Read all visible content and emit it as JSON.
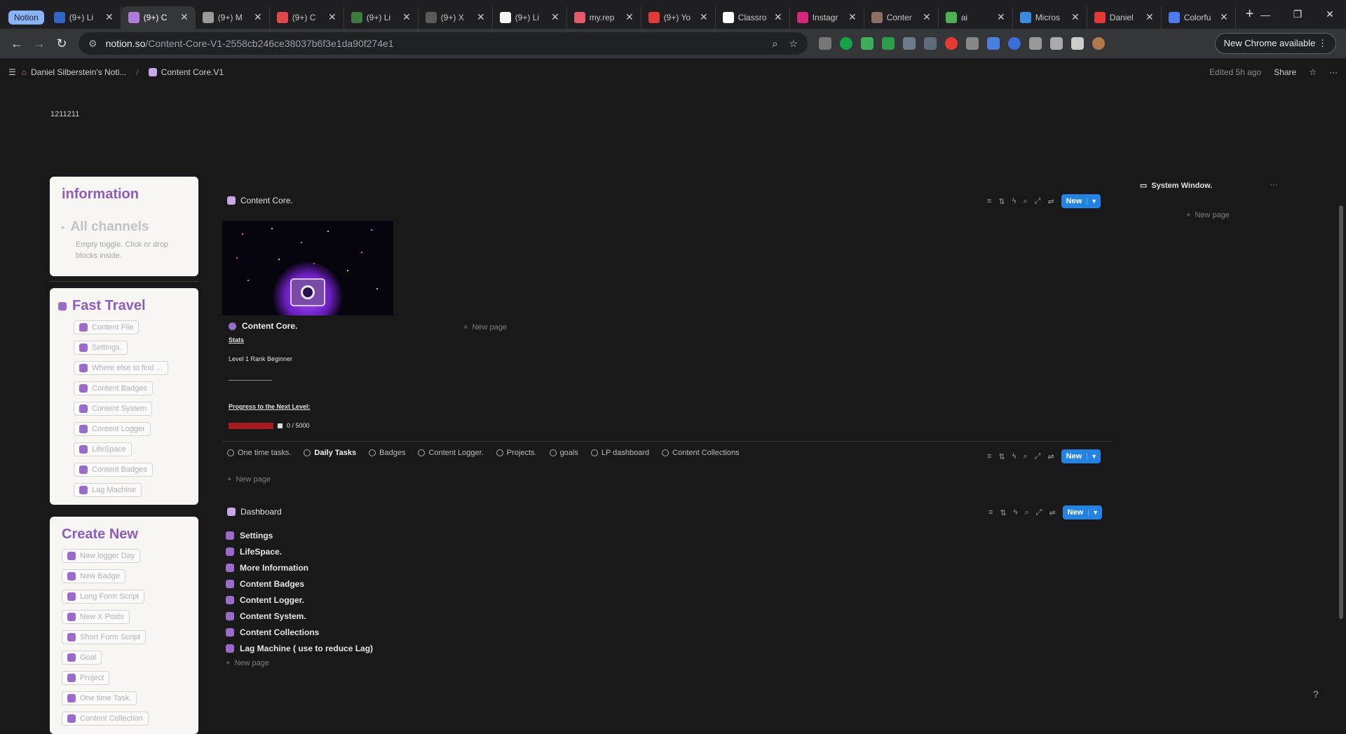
{
  "browser": {
    "tab_group": "Notion",
    "tabs": [
      {
        "title": "(9+) Li",
        "color": "#2f66c8"
      },
      {
        "title": "(9+) C",
        "color": "#b07ad8",
        "active": true
      },
      {
        "title": "(9+) M",
        "color": "#9a9a9a"
      },
      {
        "title": "(9+) C",
        "color": "#e04848"
      },
      {
        "title": "(9+) Li",
        "color": "#3c7a40"
      },
      {
        "title": "(9+) X",
        "color": "#5a5a5a"
      },
      {
        "title": "(9+) Li",
        "color": "#f5f5f5"
      },
      {
        "title": "my.rep",
        "color": "#e25b6a"
      },
      {
        "title": "(9+) Yo",
        "color": "#e53935"
      },
      {
        "title": "Classro",
        "color": "#ffffff"
      },
      {
        "title": "Instagr",
        "color": "#d6267b"
      },
      {
        "title": "Conter",
        "color": "#8d6e63"
      },
      {
        "title": "ai",
        "color": "#4caf50"
      },
      {
        "title": "Micros",
        "color": "#3d8be0"
      },
      {
        "title": "Daniel",
        "color": "#e53935"
      },
      {
        "title": "Colorfu",
        "color": "#4c7cf0"
      }
    ],
    "url_host": "notion.so",
    "url_path": "/Content-Core-V1-2558cb246ce38037b6f3e1da90f274e1",
    "new_chrome": "New Chrome available"
  },
  "notion_top": {
    "workspace": "Daniel Silberstein's Noti...",
    "page": "Content Core.V1",
    "edited": "Edited 5h ago",
    "share": "Share"
  },
  "top_number": "1211211",
  "info_card": {
    "title": "information",
    "toggle_title": "All channels",
    "toggle_hint": "Empty toggle. Click or drop blocks inside."
  },
  "fast_travel": {
    "title": "Fast Travel",
    "items": [
      "Content File",
      "Settings.",
      "Where else to find ...",
      "Content Badges",
      "Content System",
      "Content Logger",
      "LifeSpace",
      "Content Badges",
      "Lag Machine"
    ]
  },
  "create_new": {
    "title": "Create New",
    "items": [
      "New logger Day",
      "New Badge",
      "Long Form Script",
      "New X Posts",
      "Short Form Script",
      "Goal",
      "Project",
      "One time Task.",
      "Content Collection"
    ]
  },
  "content_core_db": {
    "title": "Content Core.",
    "new_label": "New",
    "card_title": "Content Core.",
    "stats_label": "Stats",
    "level_text": "Level 1 Rank Beginner",
    "progress_label": "Progress to the Next Level:",
    "progress_text": "0 / 5000",
    "progress_fraction": 0,
    "new_page": "New page"
  },
  "views": {
    "tabs": [
      "One time tasks.",
      "Daily Tasks",
      "Badges",
      "Content Logger.",
      "Projects.",
      "goals",
      "LP dashboard",
      "Content Collections"
    ],
    "active": "Daily Tasks",
    "new_label": "New",
    "new_page": "New page"
  },
  "dashboard": {
    "title": "Dashboard",
    "new_label": "New",
    "items": [
      "Settings",
      "LifeSpace.",
      "More Information",
      "Content Badges",
      "Content Logger.",
      "Content System.",
      "Content Collections",
      "Lag Machine ( use to reduce Lag)"
    ],
    "new_page": "New page"
  },
  "system_window": {
    "title": "System Window.",
    "new_page": "New page"
  },
  "colors": {
    "accent": "#8e5cbb",
    "button": "#2383e2",
    "progress": "#a61c1c"
  }
}
